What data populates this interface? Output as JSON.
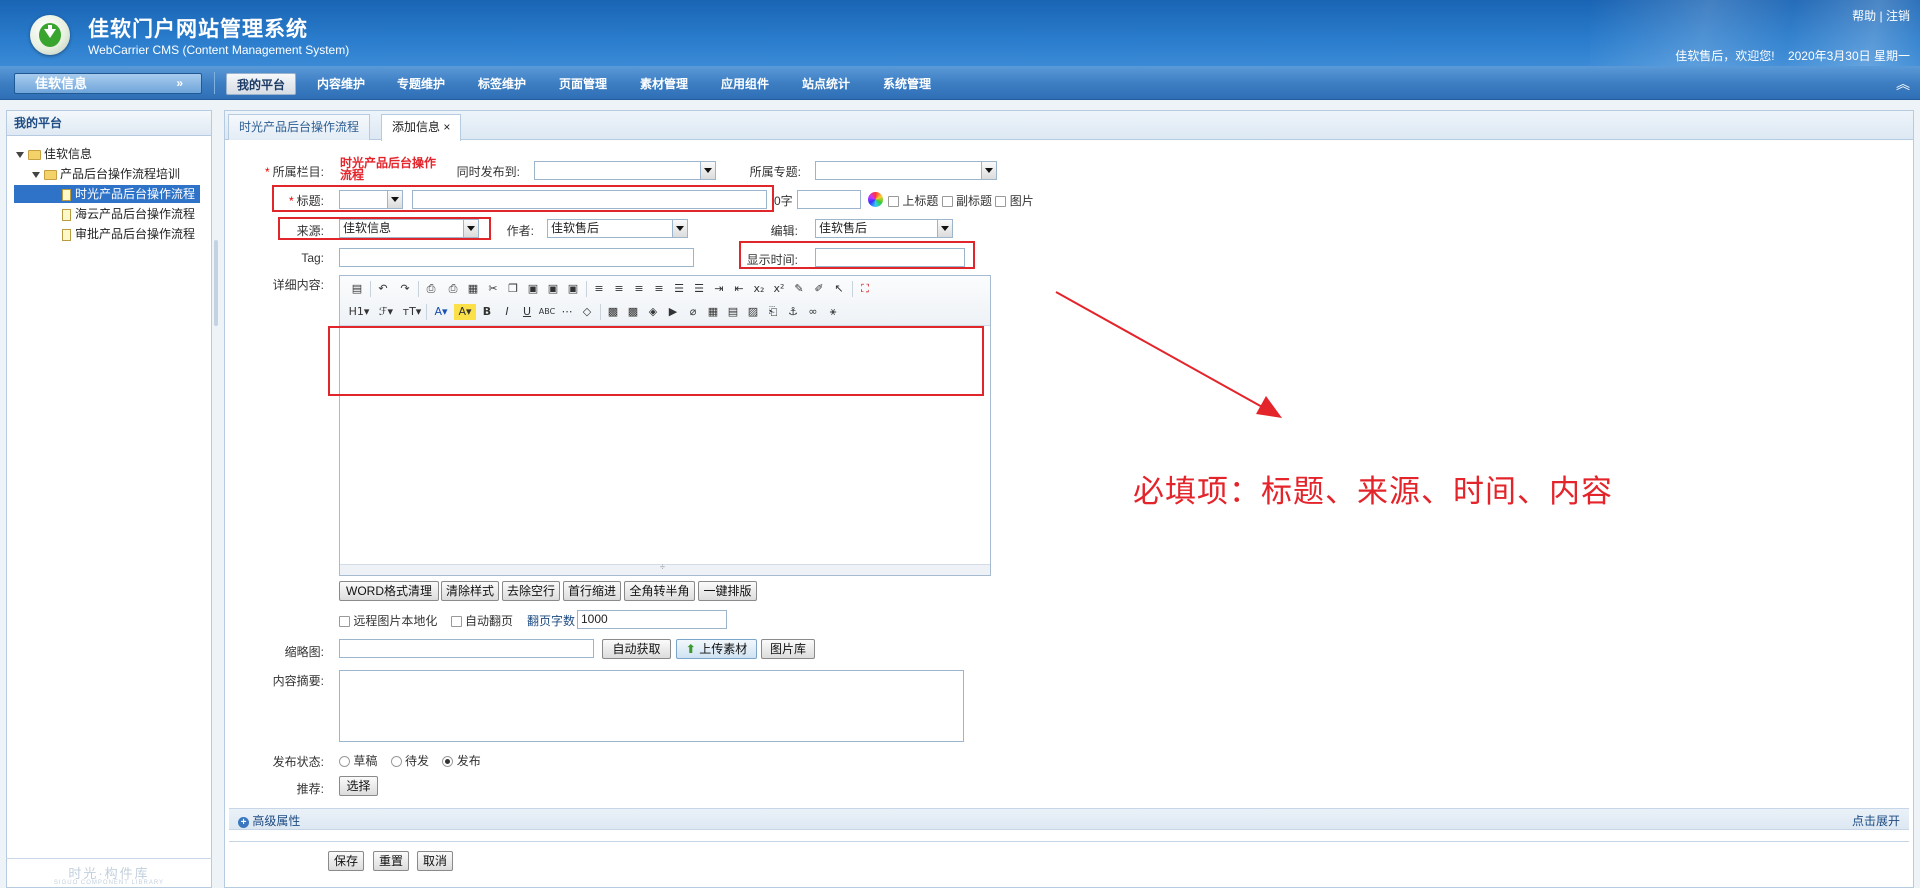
{
  "header": {
    "title": "佳软门户网站管理系统",
    "subtitle": "WebCarrier CMS (Content Management System)",
    "links": [
      "帮助",
      "注销"
    ],
    "welcome": "佳软售后，欢迎您!",
    "date": "2020年3月30日  星期一"
  },
  "nav": {
    "site_select": "佳软信息",
    "items": [
      "我的平台",
      "内容维护",
      "专题维护",
      "标签维护",
      "页面管理",
      "素材管理",
      "应用组件",
      "站点统计",
      "系统管理"
    ],
    "active_index": 0
  },
  "sidebar": {
    "title": "我的平台",
    "tree": [
      "佳软信息",
      "产品后台操作流程培训",
      "时光产品后台操作流程",
      "海云产品后台操作流程",
      "审批产品后台操作流程"
    ],
    "selected_index": 2,
    "footer": "时光·构件库",
    "footer_small": "SIGUO COMPONENT LIBRARY"
  },
  "tabs": [
    {
      "label": "时光产品后台操作流程",
      "active": false
    },
    {
      "label": "添加信息",
      "active": true,
      "close": "×"
    }
  ],
  "form": {
    "column_label": "所属栏目:",
    "column_value": "时光产品后台操作流程",
    "sync_label": "同时发布到:",
    "topic_label": "所属专题:",
    "title_label": "标题:",
    "title_count": "0字",
    "upper_title": "上标题",
    "sub_title": "副标题",
    "picture": "图片",
    "source_label": "来源:",
    "source_value": "佳软信息",
    "author_label": "作者:",
    "author_value": "佳软售后",
    "editor_label": "编辑:",
    "editor_value": "佳软售后",
    "tag_label": "Tag:",
    "show_time_label": "显示时间:",
    "content_label": "详细内容:",
    "editor_buttons": [
      "WORD格式清理",
      "清除样式",
      "去除空行",
      "首行缩进",
      "全角转半角",
      "一键排版"
    ],
    "remote_img": "远程图片本地化",
    "auto_page": "自动翻页",
    "page_chars_label": "翻页字数",
    "page_chars_value": "1000",
    "thumb_label": "缩略图:",
    "auto_fetch": "自动获取",
    "upload": "上传素材",
    "image_lib": "图片库",
    "summary_label": "内容摘要:",
    "status_label": "发布状态:",
    "status_options": [
      "草稿",
      "待发",
      "发布"
    ],
    "status_selected": 2,
    "recommend_label": "推荐:",
    "recommend_btn": "选择",
    "advanced": "高级属性",
    "expand": "点击展开",
    "save": "保存",
    "reset": "重置",
    "cancel": "取消"
  },
  "annotation": "必填项：标题、来源、时间、内容",
  "colors": {
    "header": "#2a7ccc",
    "nav": "#3e7fc4",
    "annotation": "#e4242b",
    "selected": "#2f73c9"
  }
}
